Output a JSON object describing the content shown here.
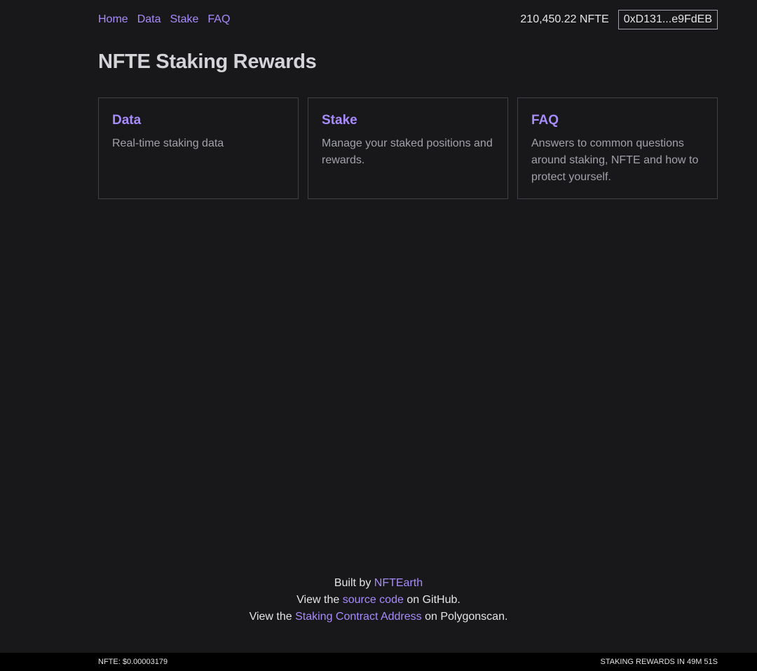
{
  "nav": {
    "home": "Home",
    "data": "Data",
    "stake": "Stake",
    "faq": "FAQ"
  },
  "wallet": {
    "balance": "210,450.22 NFTE",
    "address": "0xD131...e9FdEB"
  },
  "page": {
    "title": "NFTE Staking Rewards"
  },
  "cards": [
    {
      "title": "Data",
      "description": "Real-time staking data"
    },
    {
      "title": "Stake",
      "description": "Manage your staked positions and rewards."
    },
    {
      "title": "FAQ",
      "description": "Answers to common questions around staking, NFTE and how to protect yourself."
    }
  ],
  "footer": {
    "line1_prefix": "Built by ",
    "line1_link": "NFTEarth",
    "line2_prefix": "View the ",
    "line2_link": "source code",
    "line2_suffix": " on GitHub.",
    "line3_prefix": "View the ",
    "line3_link": "Staking Contract Address",
    "line3_suffix": " on Polygonscan."
  },
  "status_bar": {
    "price": "NFTE: $0.00003179",
    "countdown": "STAKING REWARDS IN 49M 51S"
  },
  "colors": {
    "background": "#18181b",
    "accent": "#a78bfa",
    "card_border": "#3f3f46",
    "status_bar": "#000000"
  }
}
